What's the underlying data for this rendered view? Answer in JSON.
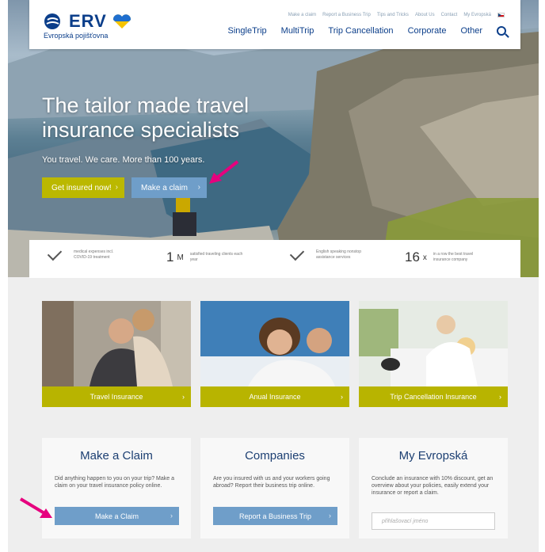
{
  "brand": {
    "name": "ERV",
    "subtitle": "Evropská pojišťovna"
  },
  "top_nav": [
    "Make a claim",
    "Report a Business Trip",
    "Tips and Tricks",
    "About Us",
    "Contact",
    "My Evropská"
  ],
  "main_nav": [
    "SingleTrip",
    "MultiTrip",
    "Trip Cancellation",
    "Corporate",
    "Other"
  ],
  "hero": {
    "title": "The tailor made travel insurance specialists",
    "subtitle": "You travel. We care. More than 100 years.",
    "btn_insured": "Get insured now!",
    "btn_claim": "Make a claim"
  },
  "stats": [
    {
      "num": "",
      "unit": "",
      "text": "medical expenses incl. COVID-19 treatment"
    },
    {
      "num": "1",
      "unit": "M",
      "text": "satisfied traveling clients each year"
    },
    {
      "num": "",
      "unit": "",
      "text": "English speaking nonstop assistance services"
    },
    {
      "num": "16",
      "unit": "x",
      "text": "in a row the best travel insurance company"
    }
  ],
  "cards": [
    "Travel Insurance",
    "Anual Insurance",
    "Trip Cancellation Insurance"
  ],
  "boxes": {
    "claim": {
      "title": "Make a Claim",
      "text": "Did anything happen to you on your trip? Make a claim on your travel insurance policy online.",
      "button": "Make a Claim"
    },
    "companies": {
      "title": "Companies",
      "text": "Are you insured with us and your workers going abroad? Report their business trip online.",
      "button": "Report a Business Trip"
    },
    "evropska": {
      "title": "My Evropská",
      "text": "Conclude an insurance with 10% discount, get an overview about your policies, easily extend your insurance or report a claim.",
      "placeholder": "přihlašovací jméno"
    }
  },
  "colors": {
    "accent": "#b8b400",
    "blue_button": "#6f9ec9",
    "navy": "#0b3e8a",
    "annotation_arrow": "#e6007e"
  }
}
